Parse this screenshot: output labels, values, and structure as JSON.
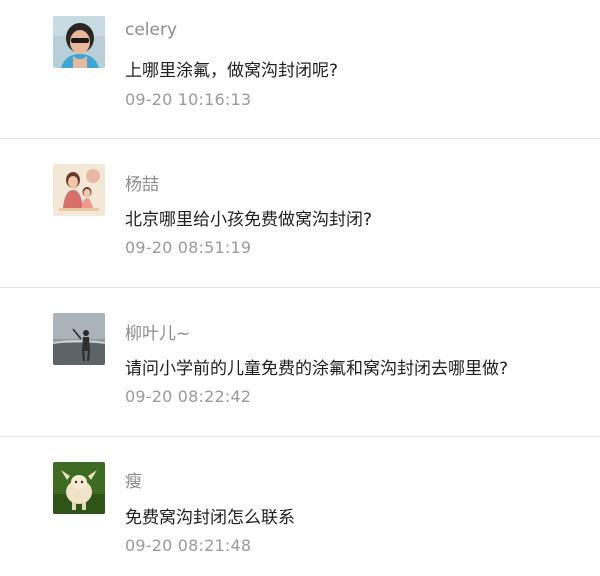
{
  "comments": [
    {
      "author": "celery",
      "text": "上哪里涂氟，做窝沟封闭呢?",
      "time": "09-20 10:16:13",
      "avatar_icon": "photo-avatar-woman"
    },
    {
      "author": "杨喆",
      "text": "北京哪里给小孩免费做窝沟封闭?",
      "time": "09-20 08:51:19",
      "avatar_icon": "illustration-avatar-mother-child"
    },
    {
      "author": "柳叶儿~",
      "text": "请问小学前的儿童免费的涂氟和窝沟封闭去哪里做?",
      "time": "09-20 08:22:42",
      "avatar_icon": "photo-avatar-person-beach"
    },
    {
      "author": "瘦",
      "text": "免费窝沟封闭怎么联系",
      "time": "09-20 08:21:48",
      "avatar_icon": "photo-avatar-lamb"
    }
  ]
}
